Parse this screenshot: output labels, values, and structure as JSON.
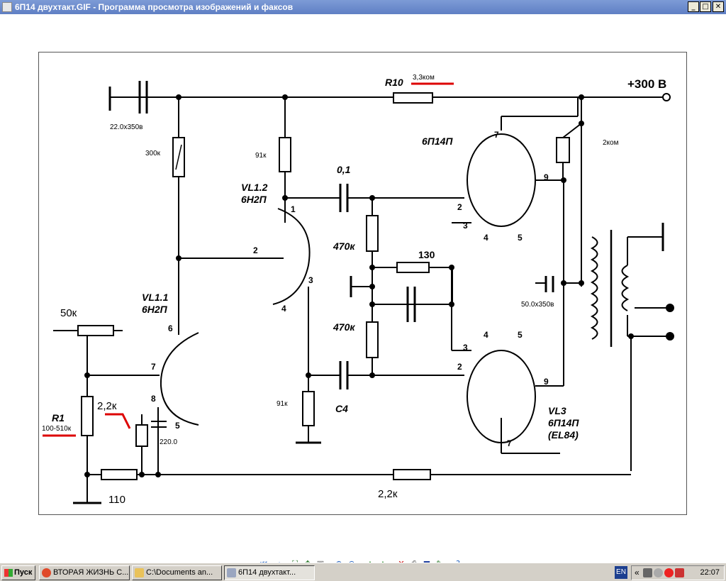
{
  "window": {
    "title": "6П14  двухтакт.GIF - Программа просмотра изображений и факсов",
    "min": "_",
    "max": "□",
    "close": "✕"
  },
  "schematic": {
    "supply": "+300 В",
    "r10": "R10",
    "r10_val": "3,3ком",
    "c_main": "22.0x350в",
    "r300k": "300к",
    "r91k_top": "91к",
    "vl12_a": "VL1.2",
    "vl12_b": "6Н2П",
    "c01": "0,1",
    "vl3top": "6П14П",
    "r2k": "2ком",
    "r470_1": "470к",
    "r470_2": "470к",
    "r130": "130",
    "c50": "50.0x350в",
    "vl11_a": "VL1.1",
    "vl11_b": "6Н2П",
    "pot": "50к",
    "r1": "R1",
    "r1_val": "100-510к",
    "r22a": "2,2к",
    "c220": "220.0",
    "r110": "110",
    "r91k_bot": "91к",
    "c4": "С4",
    "vl3_a": "VL3",
    "vl3_b": "6П14П",
    "vl3_c": "(EL84)",
    "r22b": "2,2к",
    "p1": "1",
    "p2": "2",
    "p3": "3",
    "p4": "4",
    "p5": "5",
    "p6": "6",
    "p7": "7",
    "p8": "8",
    "p9": "9"
  },
  "toolbar": {
    "icons": [
      "prev-image-icon",
      "next-image-icon",
      "best-fit-icon",
      "actual-size-icon",
      "slideshow-icon",
      "zoom-in-icon",
      "zoom-out-icon",
      "rotate-cw-icon",
      "rotate-ccw-icon",
      "delete-icon",
      "print-icon",
      "save-icon",
      "open-editor-icon",
      "help-icon"
    ]
  },
  "taskbar": {
    "start": "Пуск",
    "tasks": [
      "ВТОРАЯ ЖИЗНЬ С...",
      "C:\\Documents an...",
      "6П14  двухтакт..."
    ],
    "lang": "EN",
    "chevron": "«",
    "clock": "22:07"
  }
}
